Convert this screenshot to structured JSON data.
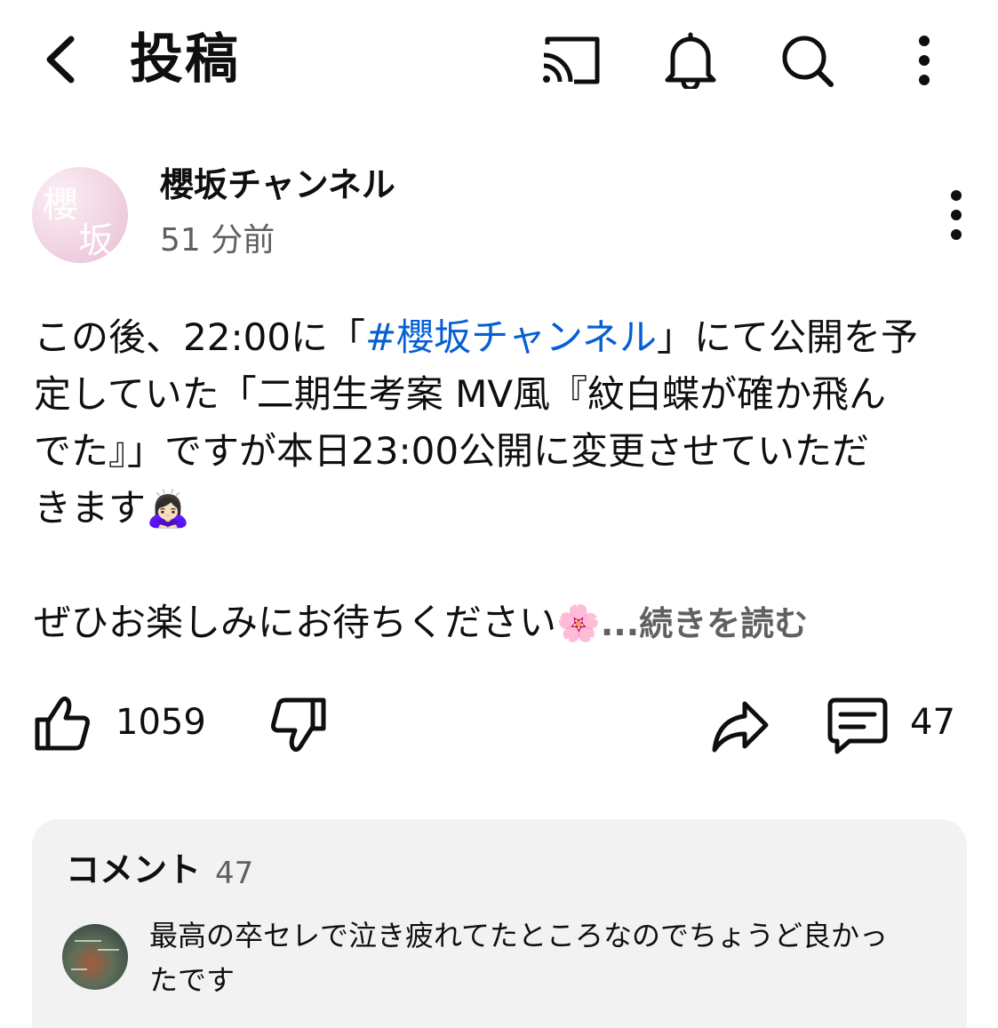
{
  "header": {
    "title": "投稿",
    "icons": [
      "back-arrow-icon",
      "cast-icon",
      "bell-icon",
      "search-icon",
      "more-vertical-icon"
    ]
  },
  "post": {
    "channel_name": "櫻坂チャンネル",
    "time_ago": "51 分前",
    "avatar_text_1": "櫻",
    "avatar_text_2": "坂",
    "line1_a": "この後、22:00に「",
    "hashtag": "#櫻坂チャンネル",
    "line1_b": "」にて公開を予",
    "line2": "定していた「二期生考案 MV風『紋白蝶が確か飛ん",
    "line3": "でた』」ですが本日23:00公開に変更させていただ",
    "line4": "きます",
    "emoji_bow": "🙇🏻‍♀️",
    "line5": "ぜひお楽しみにお待ちください",
    "emoji_blossom": "🌸",
    "read_more": "...続きを読む"
  },
  "actions": {
    "like_count": "1059",
    "comment_count": "47"
  },
  "comments": {
    "heading": "コメント",
    "count": "47",
    "top_comment_line1": "最高の卒セレで泣き疲れてたところなのでちょうど良かっ",
    "top_comment_line2": "たです"
  },
  "colors": {
    "hashtag": "#065fd4",
    "secondary_text": "#606060",
    "panel_bg": "#f2f2f2"
  }
}
